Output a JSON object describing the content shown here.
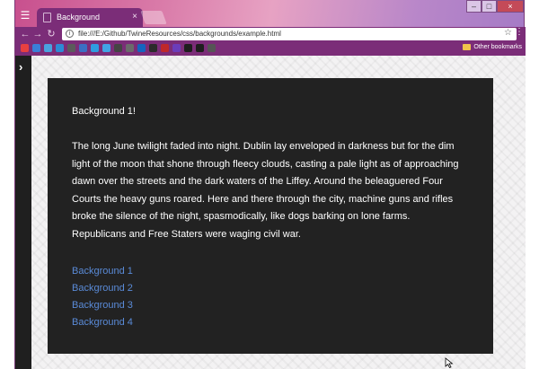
{
  "browser": {
    "tab_title": "Background",
    "address": "file:///E:/Github/TwineResources/css/backgrounds/example.html",
    "other_bookmarks": "Other bookmarks",
    "bookmark_colors": [
      "#e84040",
      "#3a7fd8",
      "#4aa3e0",
      "#2d8bd6",
      "#5b5b5b",
      "#3b6fc4",
      "#2e9ce0",
      "#42a4e6",
      "#444444",
      "#6b6b6b",
      "#1565c0",
      "#2b2b2b",
      "#c0282a",
      "#6b3dbb",
      "#1e1e1e",
      "#1e1e1e",
      "#555555"
    ]
  },
  "page": {
    "heading": "Background 1!",
    "paragraph": "The long June twilight faded into night. Dublin lay enveloped in darkness but for the dim light of the moon that shone through fleecy clouds, casting a pale light as of approaching dawn over the streets and the dark waters of the Liffey. Around the beleaguered Four Courts the heavy guns roared. Here and there through the city, machine guns and rifles broke the silence of the night, spasmodically, like dogs barking on lone farms. Republicans and Free Staters were waging civil war.",
    "links": [
      "Background 1",
      "Background 2",
      "Background 3",
      "Background 4"
    ]
  }
}
